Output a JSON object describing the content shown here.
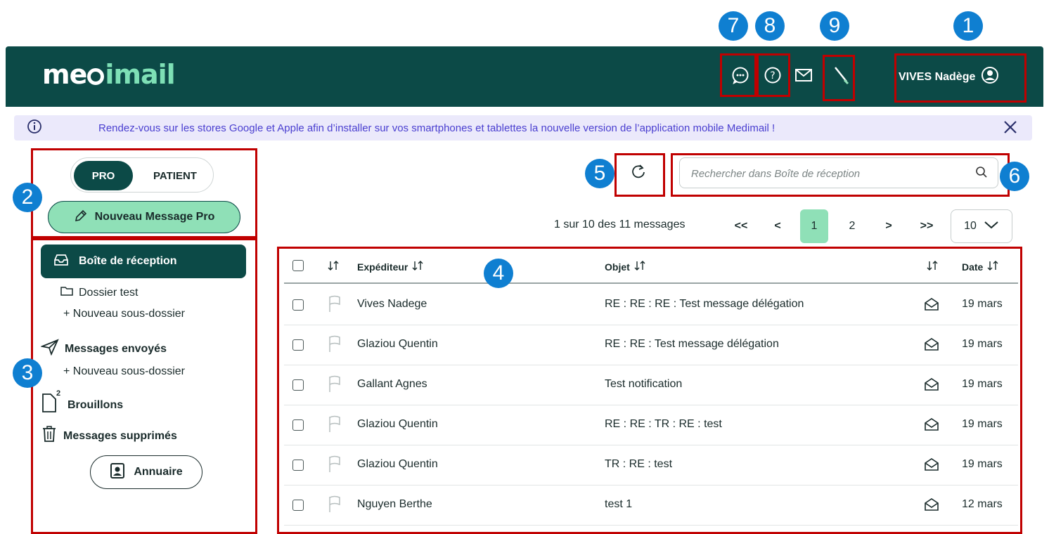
{
  "header": {
    "logo_part1": "me",
    "logo_part2": "imail",
    "user_name": "VIVES Nadège"
  },
  "annotations": [
    "1",
    "2",
    "3",
    "4",
    "5",
    "6",
    "7",
    "8",
    "9"
  ],
  "info_banner": {
    "text": "Rendez-vous sur les stores Google et Apple afin d’installer sur vos smartphones et tablettes la nouvelle version de l’application mobile Medimail !"
  },
  "sidebar": {
    "toggle_pro": "PRO",
    "toggle_patient": "PATIENT",
    "new_message": "Nouveau Message Pro",
    "inbox": "Boîte de réception",
    "folder_test": "Dossier test",
    "new_subfolder_1": "+ Nouveau sous-dossier",
    "sent": "Messages envoyés",
    "new_subfolder_2": "+ Nouveau sous-dossier",
    "drafts": "Brouillons",
    "drafts_count": "2",
    "deleted": "Messages supprimés",
    "directory": "Annuaire"
  },
  "toolbar": {
    "search_placeholder": "Rechercher dans Boîte de réception"
  },
  "pagination": {
    "summary": "1 sur 10 des 11 messages",
    "first": "<<",
    "prev": "<",
    "page1": "1",
    "page2": "2",
    "next": ">",
    "last": ">>",
    "per_page": "10"
  },
  "table": {
    "col_sender": "Expéditeur",
    "col_subject": "Objet",
    "col_date": "Date",
    "rows": [
      {
        "sender": "Vives Nadege",
        "subject": "RE : RE : RE : Test message délégation",
        "date": "19 mars"
      },
      {
        "sender": "Glaziou Quentin",
        "subject": "RE : RE : Test message délégation",
        "date": "19 mars"
      },
      {
        "sender": "Gallant Agnes",
        "subject": "Test notification",
        "date": "19 mars"
      },
      {
        "sender": "Glaziou Quentin",
        "subject": "RE : RE : TR : RE : test",
        "date": "19 mars"
      },
      {
        "sender": "Glaziou Quentin",
        "subject": "TR : RE : test",
        "date": "19 mars"
      },
      {
        "sender": "Nguyen Berthe",
        "subject": "test 1",
        "date": "12 mars"
      }
    ]
  },
  "colors": {
    "brand_dark": "#0c4a47",
    "brand_mint": "#8fe0b7",
    "annotation_red": "#c00000",
    "annotation_blue": "#0f7fd1",
    "banner_bg": "#ebe9fb",
    "banner_text": "#4a3fd0"
  }
}
